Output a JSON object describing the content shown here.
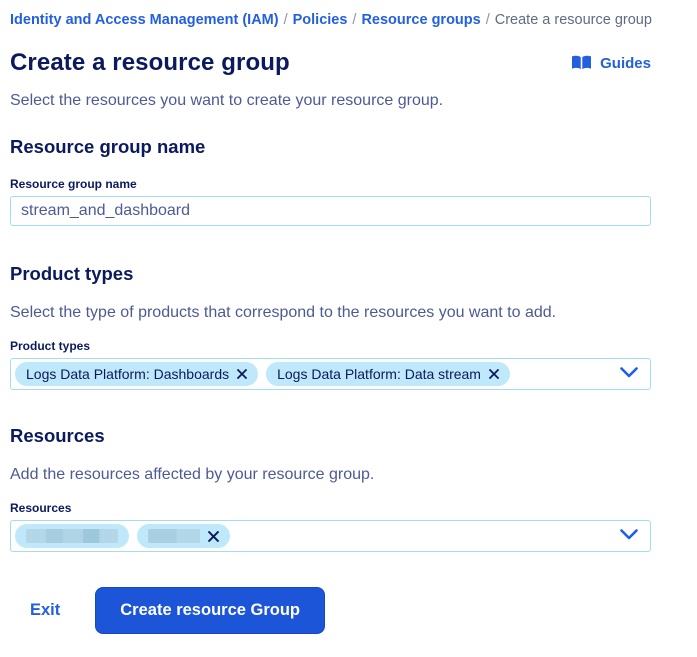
{
  "breadcrumb": {
    "separator": "/",
    "items": [
      {
        "label": "Identity and Access Management (IAM)"
      },
      {
        "label": "Policies"
      },
      {
        "label": "Resource groups"
      },
      {
        "label": "Create a resource group"
      }
    ]
  },
  "header": {
    "title": "Create a resource group",
    "guides_label": "Guides",
    "subtitle": "Select the resources you want to create your resource group."
  },
  "sections": {
    "name": {
      "heading": "Resource group name",
      "field_label": "Resource group name",
      "field_value": "stream_and_dashboard"
    },
    "product_types": {
      "heading": "Product types",
      "description": "Select the type of products that correspond to the resources you want to add.",
      "field_label": "Product types",
      "tags": [
        "Logs Data Platform: Dashboards",
        "Logs Data Platform: Data stream"
      ]
    },
    "resources": {
      "heading": "Resources",
      "description": "Add the resources affected by your resource group.",
      "field_label": "Resources",
      "tags": [
        {
          "redacted": true,
          "show_close": false
        },
        {
          "redacted": true,
          "show_close": true
        }
      ]
    }
  },
  "footer": {
    "exit_label": "Exit",
    "submit_label": "Create resource Group"
  },
  "colors": {
    "heading_navy": "#0b1a5e",
    "link_blue": "#2360df",
    "body_slate": "#4d5a94",
    "button_blue": "#1d55d9",
    "tag_blue": "#bfe8fb",
    "input_border_blue": "#a3ddf5",
    "breadcrumb_muted": "#5f6b82"
  },
  "icons": {
    "guides": "book-icon",
    "select": "chevron-down-icon",
    "tag_remove": "close-icon"
  }
}
